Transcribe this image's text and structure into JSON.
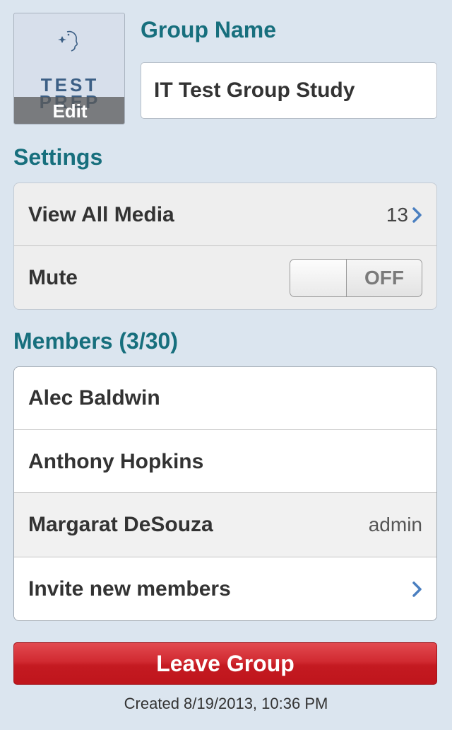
{
  "group": {
    "avatar_logo_line1": "TEST",
    "avatar_logo_line2": "PREP",
    "avatar_edit_label": "Edit",
    "name_heading": "Group Name",
    "name_value": "IT Test Group Study"
  },
  "settings": {
    "heading": "Settings",
    "view_all_media_label": "View All Media",
    "media_count": "13",
    "mute_label": "Mute",
    "mute_state": "OFF"
  },
  "members": {
    "heading": "Members (3/30)",
    "list": [
      {
        "name": "Alec Baldwin",
        "role": ""
      },
      {
        "name": "Anthony Hopkins",
        "role": ""
      },
      {
        "name": "Margarat DeSouza",
        "role": "admin"
      }
    ],
    "invite_label": "Invite new members"
  },
  "actions": {
    "leave_label": "Leave Group"
  },
  "footer": {
    "created_text": "Created 8/19/2013, 10:36 PM"
  },
  "colors": {
    "accent_teal": "#176f7d",
    "chevron_blue": "#4a7fc0",
    "leave_red": "#c41a21"
  }
}
